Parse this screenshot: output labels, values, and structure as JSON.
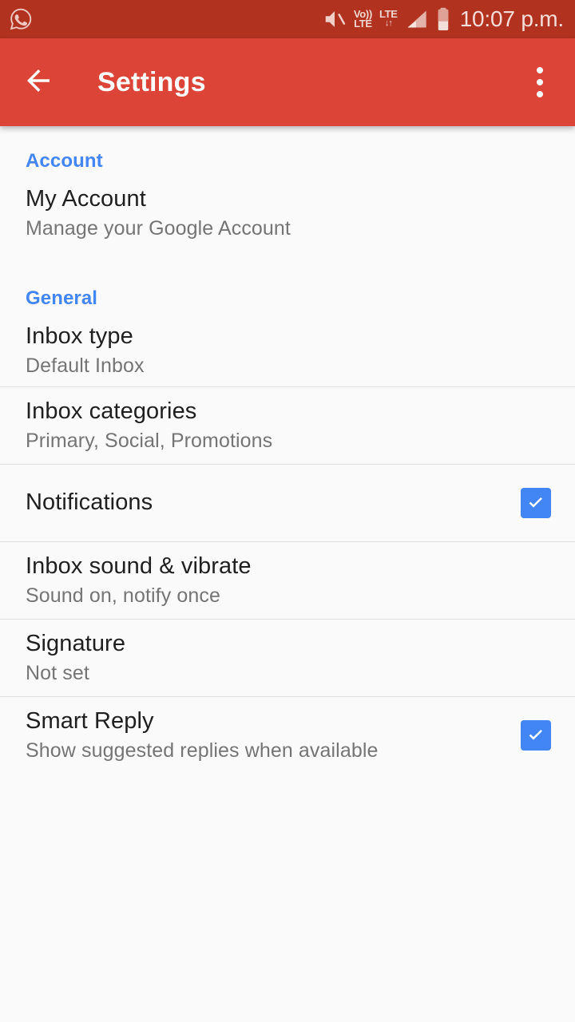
{
  "status_bar": {
    "notification_icon": "whatsapp-icon",
    "icons": [
      "volume-mute-icon",
      "volte-icon",
      "lte-data-icon",
      "signal-bars-icon",
      "battery-icon"
    ],
    "volte_top": "Vo))",
    "volte_bottom": "LTE",
    "lte_label": "LTE",
    "lte_arrows": "↓↑",
    "time": "10:07 p.m.",
    "background": "#b1321f"
  },
  "app_bar": {
    "back_icon": "back-arrow-icon",
    "title": "Settings",
    "overflow_icon": "overflow-menu-icon",
    "background": "#db4437"
  },
  "accent_color": "#4285f4",
  "sections": [
    {
      "header": "Account",
      "rows": [
        {
          "title": "My Account",
          "subtitle": "Manage your Google Account",
          "has_checkbox": false,
          "checked": false,
          "divider_after": false
        }
      ]
    },
    {
      "header": "General",
      "rows": [
        {
          "title": "Inbox type",
          "subtitle": "Default Inbox",
          "has_checkbox": false,
          "checked": false,
          "divider_after": true
        },
        {
          "title": "Inbox categories",
          "subtitle": "Primary, Social, Promotions",
          "has_checkbox": false,
          "checked": false,
          "divider_after": true
        },
        {
          "title": "Notifications",
          "subtitle": "",
          "has_checkbox": true,
          "checked": true,
          "divider_after": true
        },
        {
          "title": "Inbox sound & vibrate",
          "subtitle": "Sound on, notify once",
          "has_checkbox": false,
          "checked": false,
          "divider_after": true
        },
        {
          "title": "Signature",
          "subtitle": "Not set",
          "has_checkbox": false,
          "checked": false,
          "divider_after": true
        },
        {
          "title": "Smart Reply",
          "subtitle": "Show suggested replies when available",
          "has_checkbox": true,
          "checked": true,
          "divider_after": false
        }
      ]
    }
  ]
}
